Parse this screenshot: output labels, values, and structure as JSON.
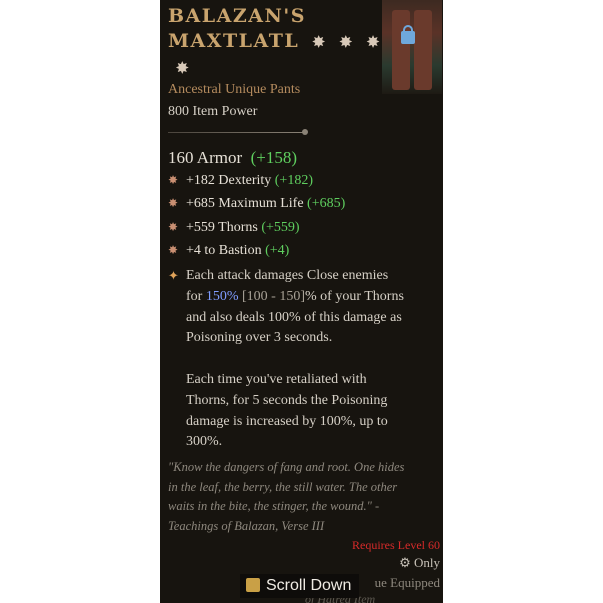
{
  "item": {
    "name_line1": "BALAZAN'S",
    "name_line2": "MAXTLATL",
    "type": "Ancestral Unique Pants",
    "item_power": "800 Item Power",
    "armor": "160 Armor",
    "armor_bonus": "(+158)"
  },
  "affixes": [
    {
      "text": "+182 Dexterity",
      "bonus": "(+182)"
    },
    {
      "text": "+685 Maximum Life",
      "bonus": "(+685)"
    },
    {
      "text": "+559 Thorns",
      "bonus": "(+559)"
    },
    {
      "text": "+4 to Bastion",
      "bonus": "(+4)"
    }
  ],
  "unique_power": {
    "line1": "Each attack damages Close enemies",
    "line2_a": "for ",
    "line2_pct": "150%",
    "line2_range": " [100 - 150]",
    "line2_b": "% of your Thorns",
    "line3": "and also deals 100% of this damage as",
    "line4": "Poisoning over 3 seconds.",
    "line5": "Each time you've retaliated with",
    "line6": "Thorns, for 5 seconds the Poisoning",
    "line7": "damage is increased by 100%, up to",
    "line8": "300%."
  },
  "flavor": {
    "line1": "\"Know the dangers of fang and root. One hides",
    "line2": "in the leaf, the berry, the still water. The other",
    "line3": "waits in the bite, the stinger, the wound.\" -",
    "line4": "Teachings of Balazan, Verse III"
  },
  "requirements": {
    "level": "Requires Level 60",
    "only": "Only",
    "equipped": "ue Equipped",
    "hatred": "of Hatred Item"
  },
  "scroll_button": "Scroll Down",
  "colors": {
    "bonus": "#5fcf5f",
    "title": "#c9a46e",
    "requirement": "#d82a2a"
  }
}
